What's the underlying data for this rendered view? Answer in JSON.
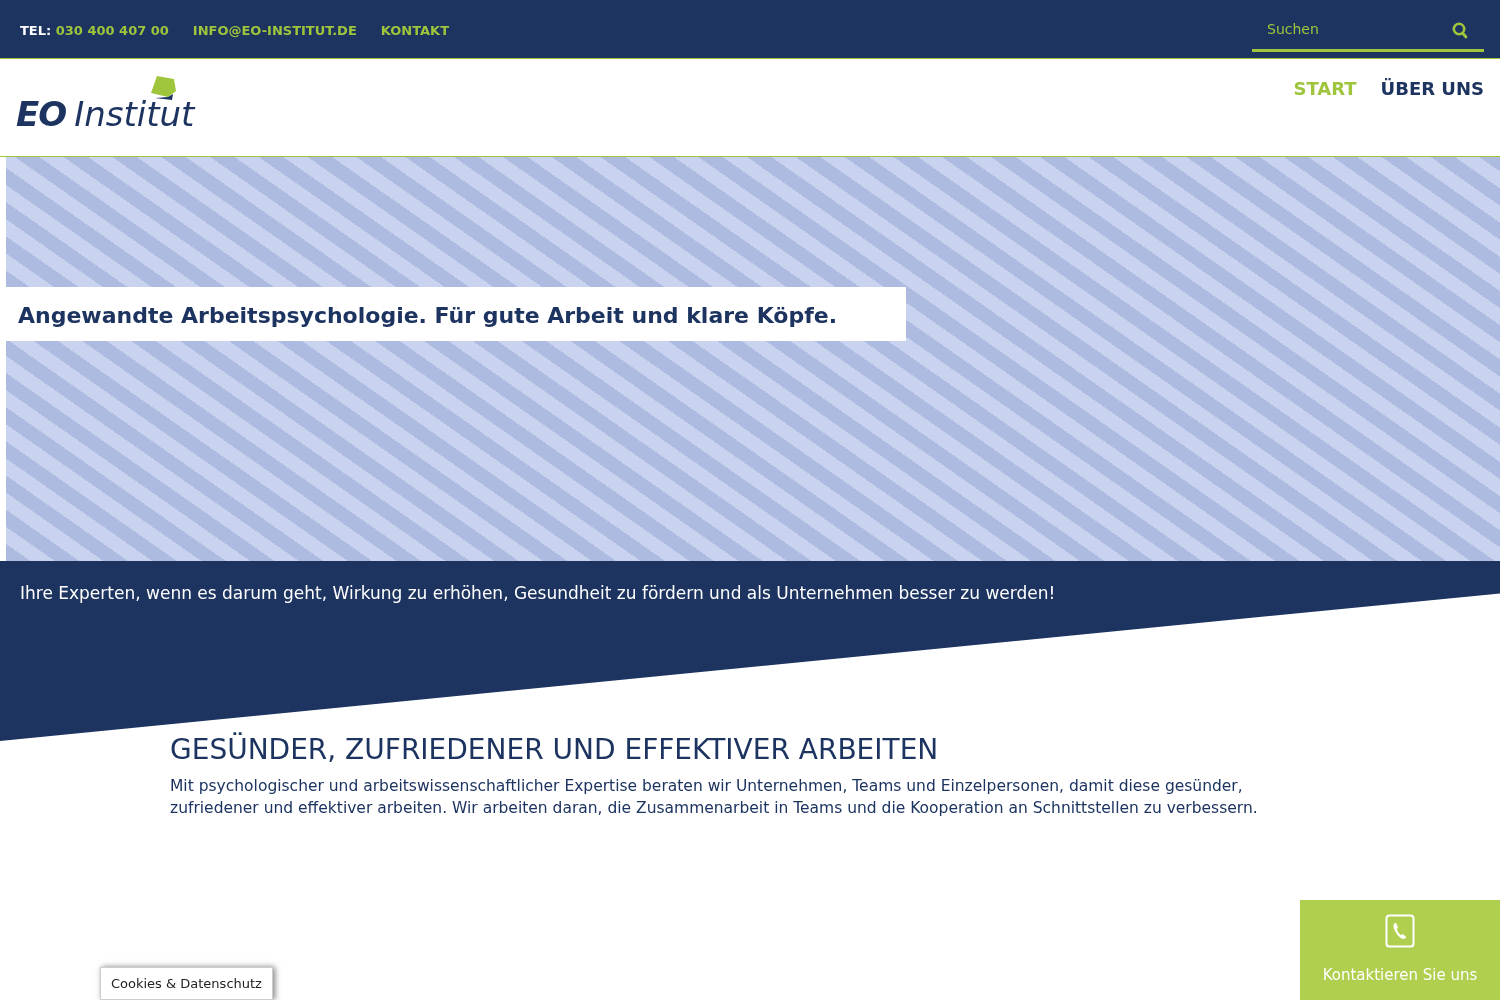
{
  "topbar": {
    "phone_label": "TEL:",
    "phone": "030 400 407 00",
    "email": "INFO@EO-INSTITUT.DE",
    "contact": "KONTAKT",
    "search": {
      "placeholder": "Suchen"
    }
  },
  "logo": {
    "bold": "EO",
    "rest": "Institut"
  },
  "nav": [
    {
      "label": "START",
      "selected": true
    },
    {
      "label": "ÜBER UNS",
      "selected": false
    }
  ],
  "hero": {
    "banner": "Angewandte Arbeitspsychologie. Für gute Arbeit und klare Köpfe."
  },
  "tagline": "Ihre Experten, wenn es darum geht, Wirkung zu erhöhen, Gesundheit zu fördern und als Unternehmen besser zu werden!",
  "section": {
    "heading": "GESÜNDER, ZUFRIEDENER UND EFFEKTIVER ARBEITEN",
    "text": "Mit psychologischer und arbeitswissenschaftlicher Expertise beraten wir Unternehmen, Teams und Einzelpersonen, damit diese gesünder, zufriedener und effektiver arbeiten. Wir arbeiten daran, die Zusammenarbeit in Teams und die Kooperation an Schnittstellen zu verbessern."
  },
  "contact_widget": {
    "label": "Kontaktieren Sie uns"
  },
  "cookie_button": "Cookies & Datenschutz"
}
